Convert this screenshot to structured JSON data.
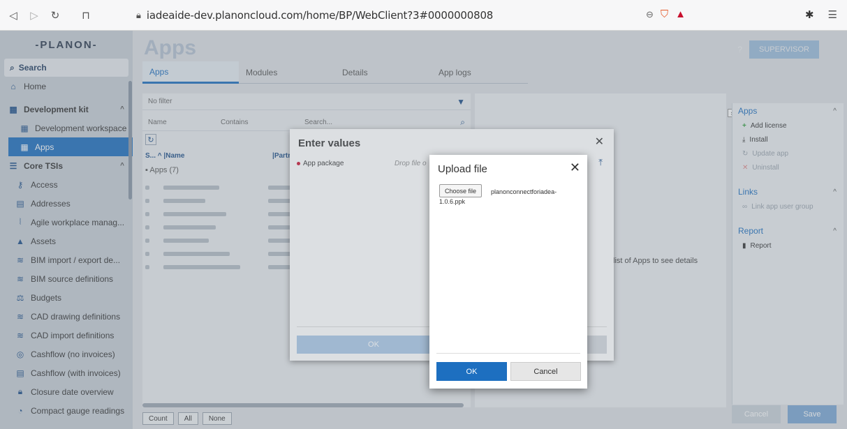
{
  "browser": {
    "url": "iadeaide-dev.planoncloud.com/home/BP/WebClient?3#0000000808"
  },
  "sidebar": {
    "logo": "-PLANON-",
    "search_label": "Search",
    "home_label": "Home",
    "dev_kit_label": "Development kit",
    "dev_items": [
      "Development workspace",
      "Apps"
    ],
    "core_label": "Core TSIs",
    "core_items": [
      "Access",
      "Addresses",
      "Agile workplace manag...",
      "Assets",
      "BIM import / export de...",
      "BIM source definitions",
      "Budgets",
      "CAD drawing definitions",
      "CAD import definitions",
      "Cashflow (no invoices)",
      "Cashflow (with invoices)",
      "Closure date overview",
      "Compact gauge readings"
    ]
  },
  "main": {
    "title": "Apps",
    "tabs": [
      "Apps",
      "Modules",
      "Details",
      "App logs"
    ],
    "permission_button": "SUPERVISOR",
    "filter": {
      "no_filter": "No filter",
      "field": "Name",
      "operator": "Contains",
      "search_placeholder": "Search..."
    },
    "list": {
      "col_s": "S...",
      "col_name": "Name",
      "col_partner": "Partne",
      "group_label": "Apps (7)"
    },
    "detail_hint": "list of Apps to see details",
    "bottom_buttons": [
      "Count",
      "All",
      "None"
    ],
    "cancel": "Cancel",
    "save": "Save"
  },
  "actions": {
    "apps_head": "Apps",
    "apps_items": [
      "Add license",
      "Install",
      "Update app",
      "Uninstall"
    ],
    "links_head": "Links",
    "links_items": [
      "Link app user group"
    ],
    "report_head": "Report",
    "report_items": [
      "Report"
    ]
  },
  "enter_values": {
    "title": "Enter values",
    "field_label": "App package",
    "drop_hint": "Drop file o",
    "ok": "OK"
  },
  "upload": {
    "title": "Upload file",
    "choose_label": "Choose file",
    "file_name": "planonconnectforiadea-1.0.6.ppk",
    "ok": "OK",
    "cancel": "Cancel"
  }
}
